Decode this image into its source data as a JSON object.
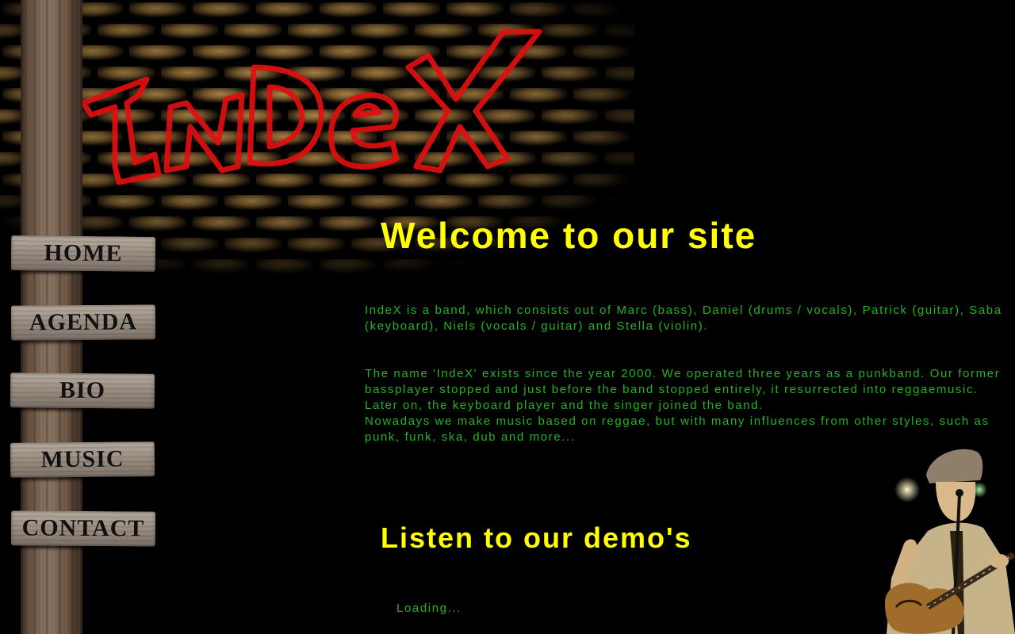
{
  "brand": {
    "graffiti_text": "InDeX"
  },
  "nav": {
    "items": [
      {
        "label": "HOME"
      },
      {
        "label": "AGENDA"
      },
      {
        "label": "BIO"
      },
      {
        "label": "MUSIC"
      },
      {
        "label": "CONTACT"
      }
    ]
  },
  "main": {
    "welcome_title": "Welcome to our site",
    "intro": "IndeX is a band, which consists out of Marc (bass), Daniel (drums / vocals), Patrick (guitar), Saba (keyboard), Niels (vocals / guitar) and Stella (violin).",
    "history_lines": [
      "The name 'IndeX' exists since the year 2000. We operated three years as a punkband. Our former bassplayer stopped and just before the band stopped entirely, it resurrected into reggaemusic. Later on, the keyboard player and the singer joined the band.",
      "Nowadays we make music based on reggae, but with many influences from other styles, such as punk, funk, ska, dub and more..."
    ],
    "demo_title": "Listen to our demo's",
    "player_status": "Loading..."
  },
  "colors": {
    "title": "#ffff00",
    "body_text": "#22b222",
    "graffiti": "#e01010",
    "background": "#000000"
  }
}
